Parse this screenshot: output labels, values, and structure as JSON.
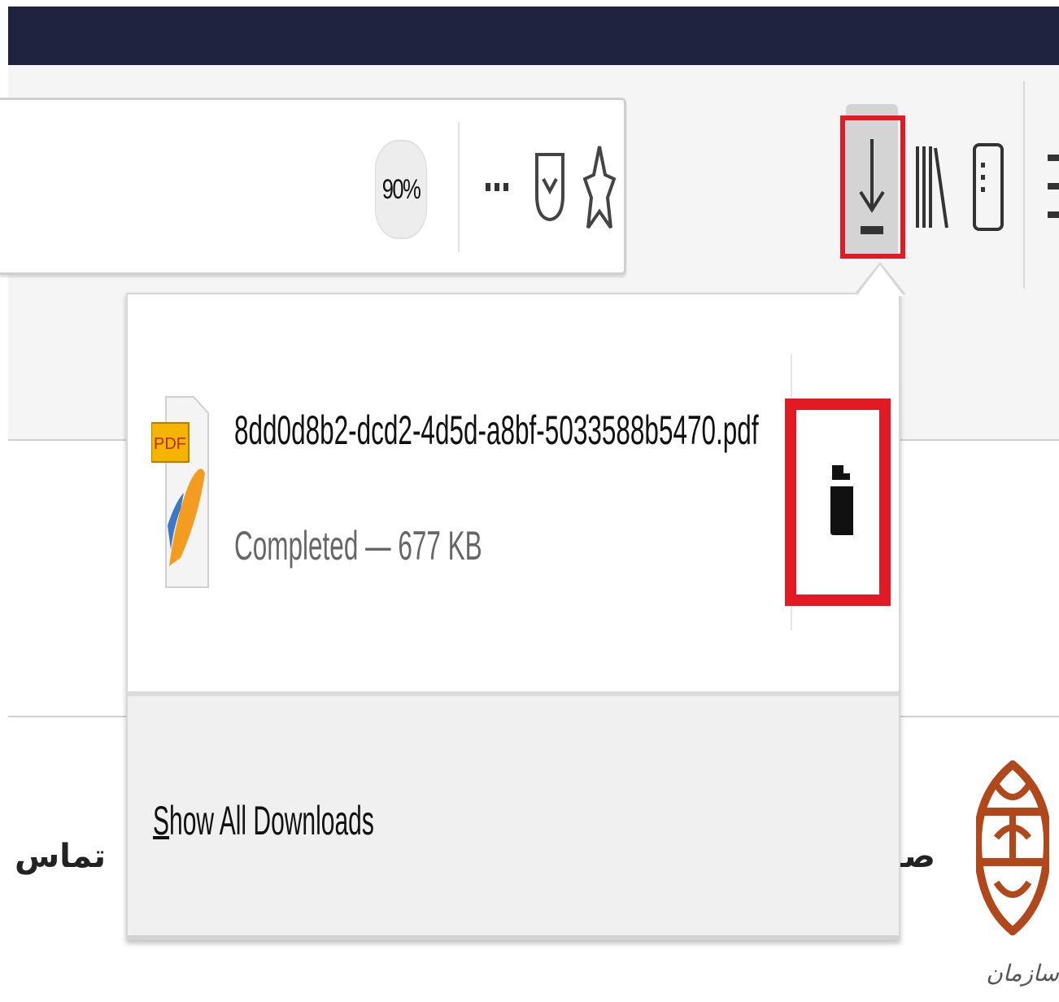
{
  "toolbar": {
    "zoom_level": "90%",
    "more_icon": "ellipsis-icon",
    "pocket_icon": "pocket-icon",
    "bookmark_icon": "star-icon",
    "downloads_icon": "download-arrow-icon",
    "library_icon": "library-icon",
    "sidebar_icon": "sidebar-icon",
    "menu_icon": "hamburger-menu-icon"
  },
  "downloads_panel": {
    "items": [
      {
        "file_icon": "pdf-file-icon",
        "file_badge": "PDF",
        "file_name": "8dd0d8b2-dcd2-4d5d-a8bf-5033588b5470.pdf",
        "status": "Completed — 677 KB",
        "action_icon": "open-containing-folder-icon"
      }
    ],
    "footer": {
      "show_all_accel": "S",
      "show_all_rest": "how All Downloads"
    }
  },
  "page": {
    "contact_link": "تماس با م",
    "home_link": "صف",
    "logo_caption": "سازمان"
  },
  "colors": {
    "title_strip": "#1f2340",
    "highlight": "#e11a24",
    "logo": "#b0481c"
  }
}
